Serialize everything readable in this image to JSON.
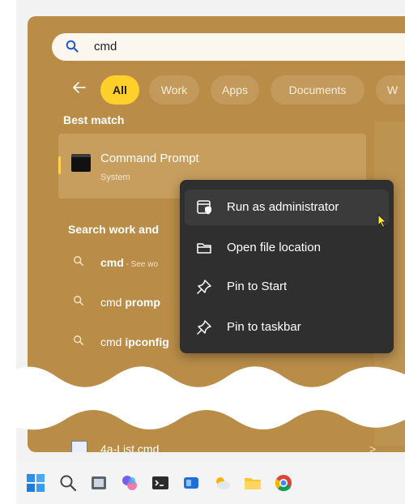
{
  "search": {
    "query": "cmd"
  },
  "filters": {
    "tabs": [
      {
        "label": "All",
        "active": true
      },
      {
        "label": "Work",
        "active": false
      },
      {
        "label": "Apps",
        "active": false
      },
      {
        "label": "Documents",
        "active": false
      },
      {
        "label": "W",
        "active": false
      }
    ]
  },
  "best_match": {
    "heading": "Best match",
    "title": "Command Prompt",
    "subtitle": "System"
  },
  "search_section": {
    "heading": "Search work and",
    "items": [
      {
        "bold": "cmd",
        "suffix": " - See wo",
        "chevron": ""
      },
      {
        "normal": "cmd ",
        "bold": "promp",
        "chevron": ""
      },
      {
        "normal": "cmd ",
        "bold": "ipconfig",
        "chevron": ">"
      }
    ],
    "last_item": {
      "label": "4a-List.cmd",
      "chevron": ">"
    }
  },
  "context_menu": {
    "items": [
      {
        "label": "Run as administrator",
        "icon": "shield-window-icon"
      },
      {
        "label": "Open file location",
        "icon": "folder-icon"
      },
      {
        "label": "Pin to Start",
        "icon": "pin-icon"
      },
      {
        "label": "Pin to taskbar",
        "icon": "pin-icon"
      }
    ]
  },
  "taskbar": {
    "icons": [
      "start-icon",
      "search-icon",
      "app-icon",
      "copilot-icon",
      "terminal-icon",
      "widgets-icon",
      "weather-icon",
      "explorer-icon",
      "chrome-icon"
    ]
  },
  "colors": {
    "panel": "#b98d48",
    "accent": "#ffd02a",
    "menu": "#2f2f2f"
  }
}
